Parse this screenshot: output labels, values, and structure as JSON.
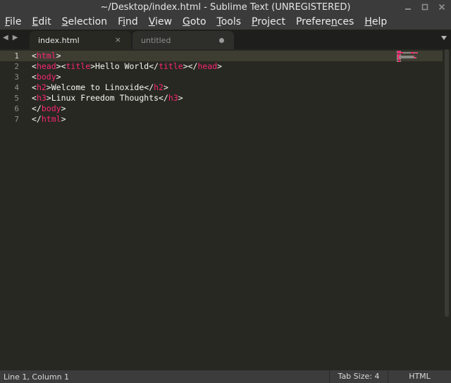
{
  "window": {
    "title": "~/Desktop/index.html - Sublime Text (UNREGISTERED)"
  },
  "menu": [
    {
      "prefix": "",
      "accel": "F",
      "rest": "ile"
    },
    {
      "prefix": "",
      "accel": "E",
      "rest": "dit"
    },
    {
      "prefix": "",
      "accel": "S",
      "rest": "election"
    },
    {
      "prefix": "F",
      "accel": "i",
      "rest": "nd"
    },
    {
      "prefix": "",
      "accel": "V",
      "rest": "iew"
    },
    {
      "prefix": "",
      "accel": "G",
      "rest": "oto"
    },
    {
      "prefix": "",
      "accel": "T",
      "rest": "ools"
    },
    {
      "prefix": "",
      "accel": "P",
      "rest": "roject"
    },
    {
      "prefix": "Prefere",
      "accel": "n",
      "rest": "ces"
    },
    {
      "prefix": "",
      "accel": "H",
      "rest": "elp"
    }
  ],
  "tabs": [
    {
      "label": "index.html",
      "close": "×"
    },
    {
      "label": "untitled"
    }
  ],
  "editor": {
    "line_numbers": [
      "1",
      "2",
      "3",
      "4",
      "5",
      "6",
      "7"
    ],
    "lines": [
      [
        {
          "t": "<"
        },
        {
          "t": "html",
          "tag": true
        },
        {
          "t": ">"
        }
      ],
      [
        {
          "t": "<"
        },
        {
          "t": "head",
          "tag": true
        },
        {
          "t": "><"
        },
        {
          "t": "title",
          "tag": true
        },
        {
          "t": ">Hello World</"
        },
        {
          "t": "title",
          "tag": true
        },
        {
          "t": "></"
        },
        {
          "t": "head",
          "tag": true
        },
        {
          "t": ">"
        }
      ],
      [
        {
          "t": "<"
        },
        {
          "t": "body",
          "tag": true
        },
        {
          "t": ">"
        }
      ],
      [
        {
          "t": "<"
        },
        {
          "t": "h2",
          "tag": true
        },
        {
          "t": ">Welcome to Linoxide</"
        },
        {
          "t": "h2",
          "tag": true
        },
        {
          "t": ">"
        }
      ],
      [
        {
          "t": "<"
        },
        {
          "t": "h3",
          "tag": true
        },
        {
          "t": ">Linux Freedom Thoughts</"
        },
        {
          "t": "h3",
          "tag": true
        },
        {
          "t": ">"
        }
      ],
      [
        {
          "t": "</"
        },
        {
          "t": "body",
          "tag": true
        },
        {
          "t": ">"
        }
      ],
      [
        {
          "t": "</"
        },
        {
          "t": "html",
          "tag": true
        },
        {
          "t": ">"
        }
      ]
    ]
  },
  "status": {
    "position": "Line 1, Column 1",
    "tab_size": "Tab Size: 4",
    "syntax": "HTML"
  },
  "colors": {
    "background": "#272822",
    "tag": "#f92672",
    "text": "#f8f8f2",
    "chrome": "#3b3b3b"
  },
  "icons": {
    "minimize": "minimize-icon",
    "maximize": "maximize-icon",
    "close": "close-icon",
    "tab_prev": "arrow-left-icon",
    "tab_next": "arrow-right-icon",
    "tab_list": "chevron-down-icon"
  }
}
